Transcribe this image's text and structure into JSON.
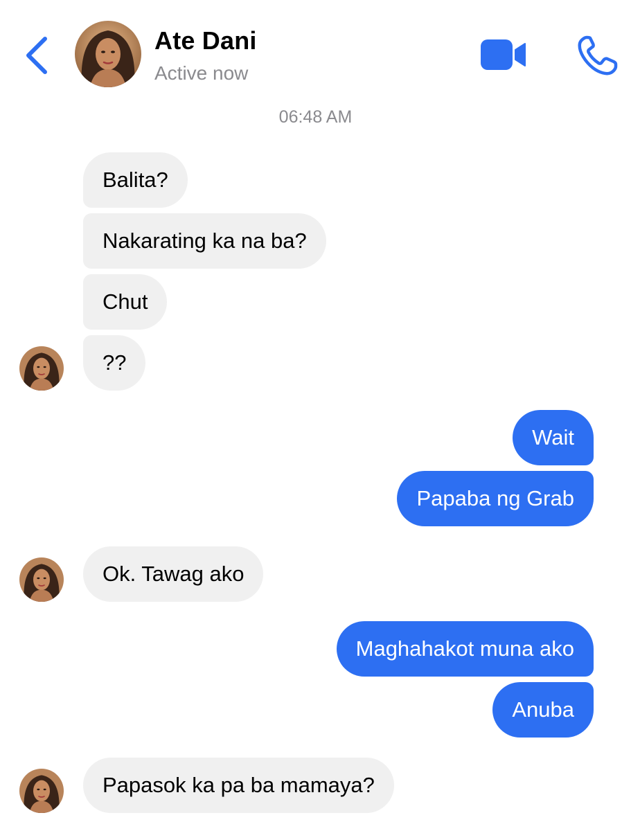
{
  "header": {
    "contact_name": "Ate Dani",
    "status": "Active now",
    "back_icon": "chevron-left-icon",
    "video_icon": "video-camera-icon",
    "call_icon": "phone-icon",
    "accent_color": "#2d6ff2"
  },
  "conversation": {
    "timestamp": "06:48 AM",
    "messages": [
      {
        "from": "contact",
        "text": "Balita?"
      },
      {
        "from": "contact",
        "text": "Nakarating ka na ba?"
      },
      {
        "from": "contact",
        "text": "Chut"
      },
      {
        "from": "contact",
        "text": "??"
      },
      {
        "from": "me",
        "text": "Wait"
      },
      {
        "from": "me",
        "text": "Papaba ng Grab"
      },
      {
        "from": "contact",
        "text": "Ok. Tawag ako"
      },
      {
        "from": "me",
        "text": "Maghahakot muna ako"
      },
      {
        "from": "me",
        "text": "Anuba"
      },
      {
        "from": "contact",
        "text": "Papasok ka pa ba mamaya?"
      }
    ]
  },
  "colors": {
    "incoming_bubble": "#f0f0f0",
    "outgoing_bubble": "#2d6ff2",
    "secondary_text": "#8a8a8e"
  }
}
